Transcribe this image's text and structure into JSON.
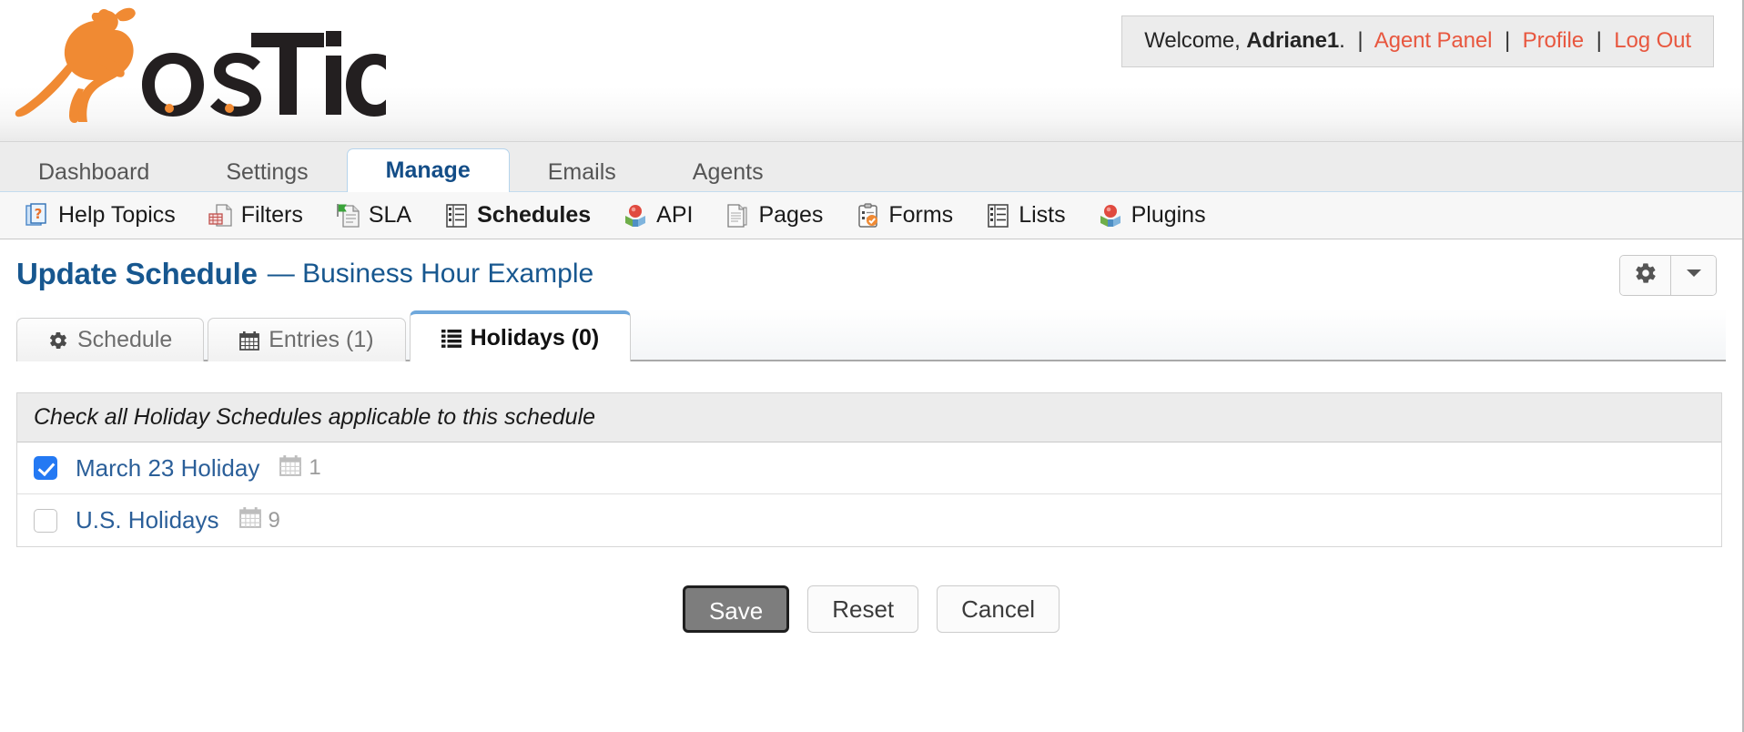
{
  "brand": {
    "logo_text_os": "os",
    "logo_text_ticket": "Ticket",
    "logo_icon": "kangaroo-logo",
    "orange": "#f08a33",
    "dark": "#231f20"
  },
  "welcome": {
    "greeting": "Welcome,",
    "username": "Adriane1",
    "period": ".",
    "divider": "|",
    "links": [
      {
        "label": "Agent Panel",
        "name": "agent-panel-link"
      },
      {
        "label": "Profile",
        "name": "profile-link"
      },
      {
        "label": "Log Out",
        "name": "log-out-link"
      }
    ],
    "link_color": "#e8573f"
  },
  "main_nav": {
    "items": [
      {
        "label": "Dashboard",
        "active": false
      },
      {
        "label": "Settings",
        "active": false
      },
      {
        "label": "Manage",
        "active": true
      },
      {
        "label": "Emails",
        "active": false
      },
      {
        "label": "Agents",
        "active": false
      }
    ],
    "active_color": "#134d87"
  },
  "sub_nav": {
    "items": [
      {
        "label": "Help Topics",
        "icon": "help-topic-icon",
        "active": false
      },
      {
        "label": "Filters",
        "icon": "filter-icon",
        "active": false
      },
      {
        "label": "SLA",
        "icon": "sla-icon",
        "active": false
      },
      {
        "label": "Schedules",
        "icon": "schedules-icon",
        "active": true
      },
      {
        "label": "API",
        "icon": "api-icon",
        "active": false
      },
      {
        "label": "Pages",
        "icon": "pages-icon",
        "active": false
      },
      {
        "label": "Forms",
        "icon": "forms-icon",
        "active": false
      },
      {
        "label": "Lists",
        "icon": "lists-icon",
        "active": false
      },
      {
        "label": "Plugins",
        "icon": "plugins-icon",
        "active": false
      }
    ]
  },
  "page": {
    "title": "Update Schedule",
    "subtitle": "— Business Hour Example",
    "title_color": "#17578f",
    "gear_icon": "gear-icon",
    "caret_icon": "chevron-down-icon"
  },
  "tabs": [
    {
      "label": "Schedule",
      "icon": "gear-icon",
      "active": false
    },
    {
      "label": "Entries (1)",
      "icon": "calendar-icon",
      "active": false
    },
    {
      "label": "Holidays (0)",
      "icon": "list-icon",
      "active": true
    }
  ],
  "table": {
    "header": "Check all Holiday Schedules applicable to this schedule",
    "rows": [
      {
        "name": "March 23 Holiday",
        "checked": true,
        "count": "1",
        "icon": "calendar-icon"
      },
      {
        "name": "U.S. Holidays",
        "checked": false,
        "count": "9",
        "icon": "calendar-icon"
      }
    ]
  },
  "buttons": [
    {
      "label": "Save",
      "style": "primary",
      "name": "save-button"
    },
    {
      "label": "Reset",
      "style": "plain",
      "name": "reset-button"
    },
    {
      "label": "Cancel",
      "style": "plain",
      "name": "cancel-button"
    }
  ]
}
